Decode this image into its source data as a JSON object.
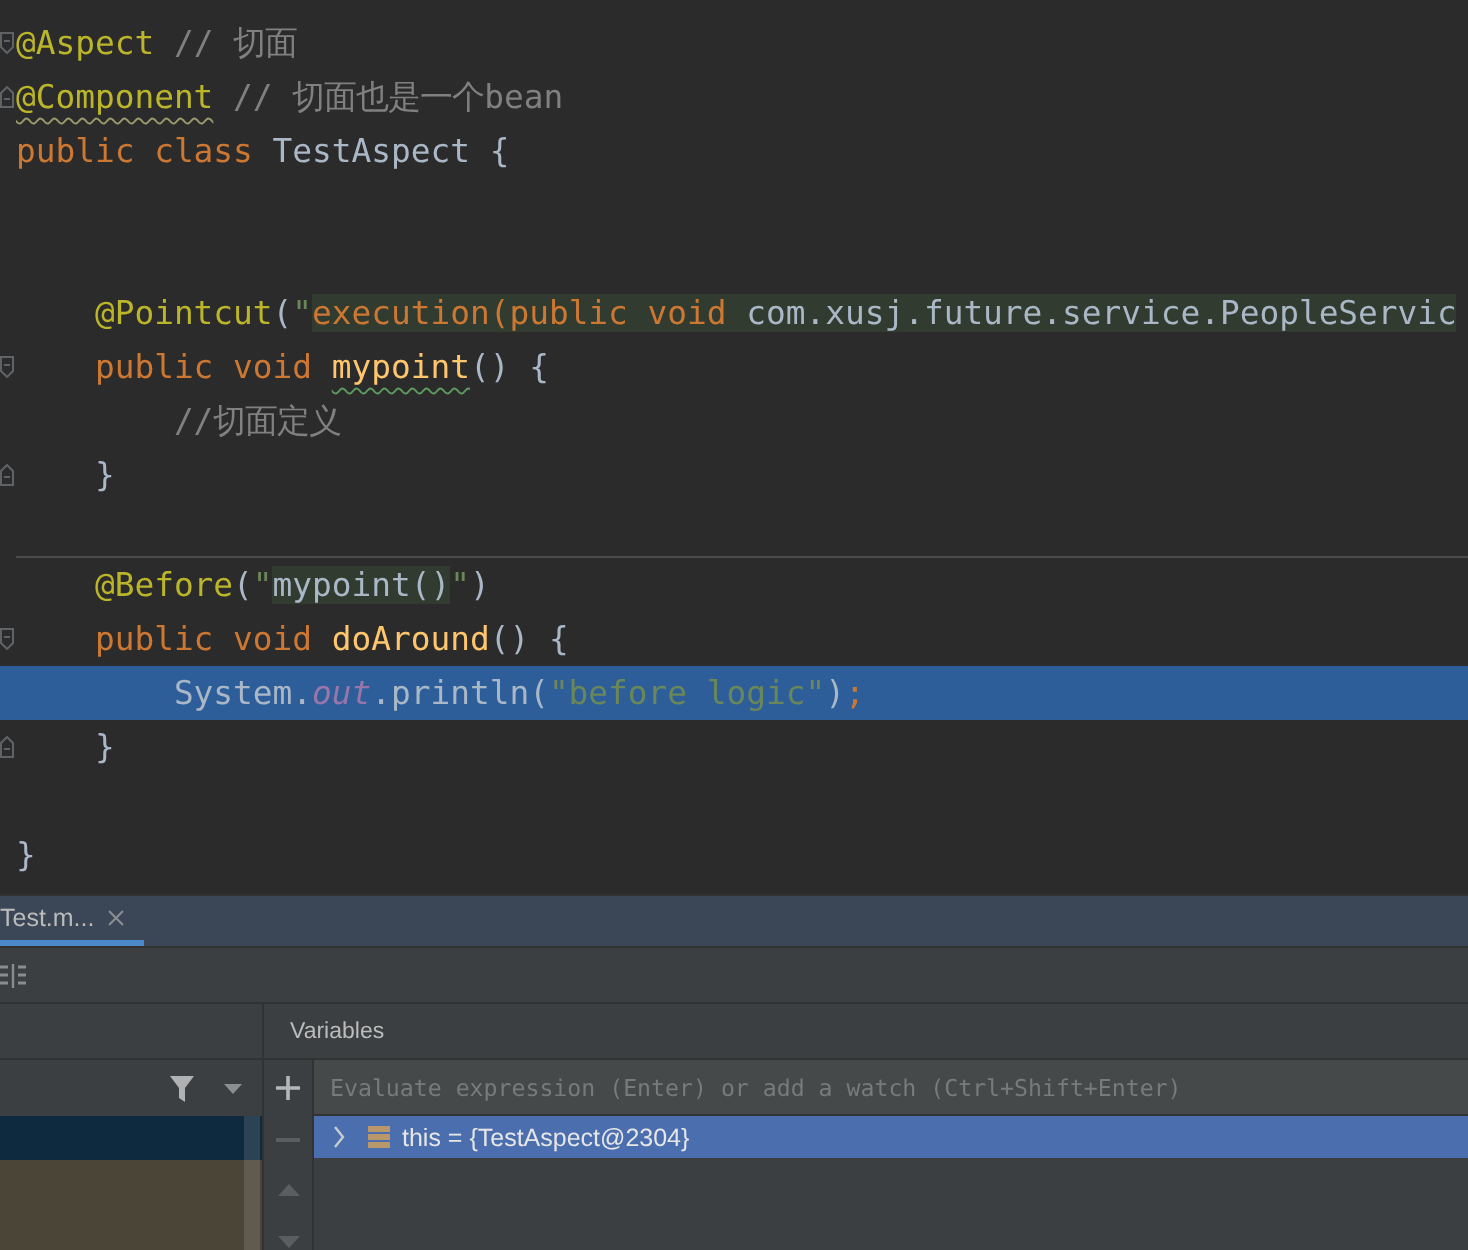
{
  "editor": {
    "lines": [
      {
        "kind": "code",
        "current": false,
        "fold_marker": {
          "kind": "start"
        },
        "tokens": [
          {
            "text": "@Aspect",
            "kind": "annotation"
          },
          {
            "text": " // 切面",
            "kind": "comment"
          }
        ]
      },
      {
        "kind": "code",
        "current": false,
        "fold_marker": {
          "kind": "end"
        },
        "tokens": [
          {
            "text": "@Component",
            "kind": "annotation",
            "underline": {
              "kind": "warning"
            }
          },
          {
            "text": " // 切面也是一个bean",
            "kind": "comment"
          }
        ]
      },
      {
        "kind": "code",
        "current": false,
        "tokens": [
          {
            "text": "public class ",
            "kind": "keyword"
          },
          {
            "text": "TestAspect {",
            "kind": "plain"
          }
        ],
        "children": [
          {
            "kind": "blank"
          },
          {
            "kind": "blank"
          },
          {
            "kind": "code",
            "current": false,
            "tokens": [
              {
                "text": "@Pointcut",
                "kind": "annotation"
              },
              {
                "text": "(",
                "kind": "plain"
              },
              {
                "text": "\"",
                "kind": "string"
              },
              {
                "kind": "fragment",
                "tokens": [
                  {
                    "text": "execution(public void ",
                    "kind": "keyword"
                  },
                  {
                    "text": "com.xusj.future.service.PeopleServic",
                    "kind": "plain"
                  }
                ]
              }
            ]
          },
          {
            "kind": "code",
            "current": false,
            "fold_marker": {
              "kind": "start"
            },
            "tokens": [
              {
                "text": "public void ",
                "kind": "keyword"
              },
              {
                "text": "mypoint",
                "kind": "method",
                "underline": {
                  "kind": "typo"
                }
              },
              {
                "text": "() {",
                "kind": "plain"
              }
            ],
            "children": [
              {
                "kind": "code",
                "current": false,
                "tokens": [
                  {
                    "text": "//切面定义",
                    "kind": "comment"
                  }
                ]
              }
            ]
          },
          {
            "kind": "code",
            "current": false,
            "fold_marker": {
              "kind": "end"
            },
            "tokens": [
              {
                "text": "}",
                "kind": "plain"
              }
            ]
          },
          {
            "kind": "blank"
          },
          {
            "kind": "separator"
          },
          {
            "kind": "code",
            "current": false,
            "tokens": [
              {
                "text": "@Before",
                "kind": "annotation"
              },
              {
                "text": "(",
                "kind": "plain"
              },
              {
                "text": "\"",
                "kind": "string"
              },
              {
                "kind": "fragment",
                "tokens": [
                  {
                    "text": "mypoint()",
                    "kind": "plain"
                  }
                ]
              },
              {
                "text": "\"",
                "kind": "string"
              },
              {
                "text": ")",
                "kind": "plain"
              }
            ]
          },
          {
            "kind": "code",
            "current": false,
            "fold_marker": {
              "kind": "start"
            },
            "tokens": [
              {
                "text": "public void ",
                "kind": "keyword"
              },
              {
                "text": "doAround",
                "kind": "method"
              },
              {
                "text": "() {",
                "kind": "plain"
              }
            ],
            "children": [
              {
                "kind": "code",
                "current": true,
                "tokens": [
                  {
                    "text": "System.",
                    "kind": "plain"
                  },
                  {
                    "text": "out",
                    "kind": "static_field"
                  },
                  {
                    "text": ".println(",
                    "kind": "plain"
                  },
                  {
                    "text": "\"before logic\"",
                    "kind": "string"
                  },
                  {
                    "text": ")",
                    "kind": "plain"
                  },
                  {
                    "text": ";",
                    "kind": "keyword"
                  }
                ]
              }
            ]
          },
          {
            "kind": "code",
            "current": false,
            "fold_marker": {
              "kind": "end"
            },
            "tokens": [
              {
                "text": "}",
                "kind": "plain"
              }
            ]
          },
          {
            "kind": "blank"
          }
        ]
      },
      {
        "kind": "code",
        "current": false,
        "tokens": [
          {
            "text": "}",
            "kind": "plain"
          }
        ]
      }
    ]
  },
  "debug_panel": {
    "tabs": [
      {
        "label": "Test.m...",
        "selected": true
      }
    ],
    "frames": {
      "rows": [
        {
          "kind": "app",
          "selected": true
        },
        {
          "kind": "library",
          "selected": false
        },
        {
          "kind": "library",
          "selected": false
        }
      ]
    },
    "variables": {
      "title": "Variables",
      "toolbar": [
        {
          "kind": "add",
          "disabled": false
        },
        {
          "kind": "remove",
          "disabled": true
        },
        {
          "kind": "move_up",
          "disabled": true
        },
        {
          "kind": "move_down",
          "disabled": true
        }
      ],
      "watch_field": {
        "placeholder": "Evaluate expression (Enter) or add a watch (Ctrl+Shift+Enter)"
      },
      "items": [
        {
          "text": "this = {TestAspect@2304}",
          "selected": true,
          "expanded": false
        }
      ]
    }
  }
}
